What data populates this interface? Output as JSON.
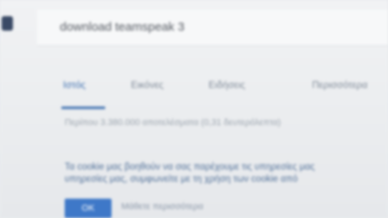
{
  "logo": {
    "text": ""
  },
  "search": {
    "query": "download teamspeak 3"
  },
  "tabs": [
    {
      "label": "Ιστός",
      "active": true
    },
    {
      "label": "Εικόνες",
      "active": false
    },
    {
      "label": "Ειδήσεις",
      "active": false
    },
    {
      "label": "Περισσότερα",
      "active": false
    }
  ],
  "results": {
    "stats": "Περίπου 3.380.000 αποτελέσματα (0,31 δευτερόλεπτα)"
  },
  "notice": {
    "line1": "Τα cookie μας βοηθούν να σας παρέχουμε τις υπηρεσίες μας",
    "line2": "υπηρεσίες μας, συμφωνείτε με τη χρήση των cookie από",
    "ok_label": "OK",
    "more_label": "Μάθετε περισσότερα"
  },
  "colors": {
    "accent": "#3d6fb0",
    "button": "#3e78c8",
    "notice_text": "#4f6f98"
  }
}
